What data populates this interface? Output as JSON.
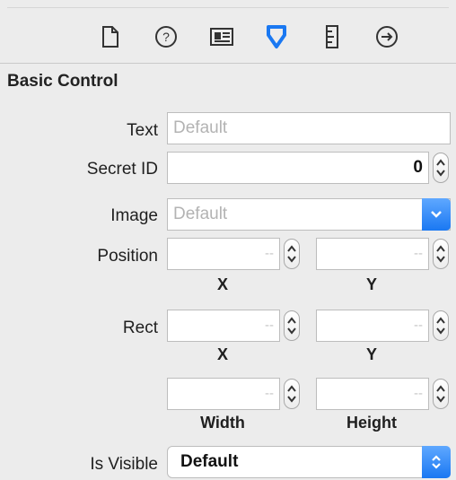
{
  "toolbar": {
    "icons": [
      "file-icon",
      "help-icon",
      "identity-icon",
      "attributes-icon",
      "size-ruler-icon",
      "connections-icon"
    ],
    "accent": "#1a78f2"
  },
  "section": {
    "title": "Basic Control"
  },
  "fields": {
    "text": {
      "label": "Text",
      "placeholder": "Default"
    },
    "secret_id": {
      "label": "Secret ID",
      "value": "0"
    },
    "image": {
      "label": "Image",
      "placeholder": "Default"
    },
    "position": {
      "label": "Position",
      "x_value": "--",
      "y_value": "--",
      "x_label": "X",
      "y_label": "Y"
    },
    "rect": {
      "label": "Rect",
      "x_value": "--",
      "y_value": "--",
      "x_label": "X",
      "y_label": "Y",
      "width_value": "--",
      "height_value": "--",
      "width_label": "Width",
      "height_label": "Height"
    },
    "is_visible": {
      "label": "Is Visible",
      "value": "Default"
    }
  }
}
